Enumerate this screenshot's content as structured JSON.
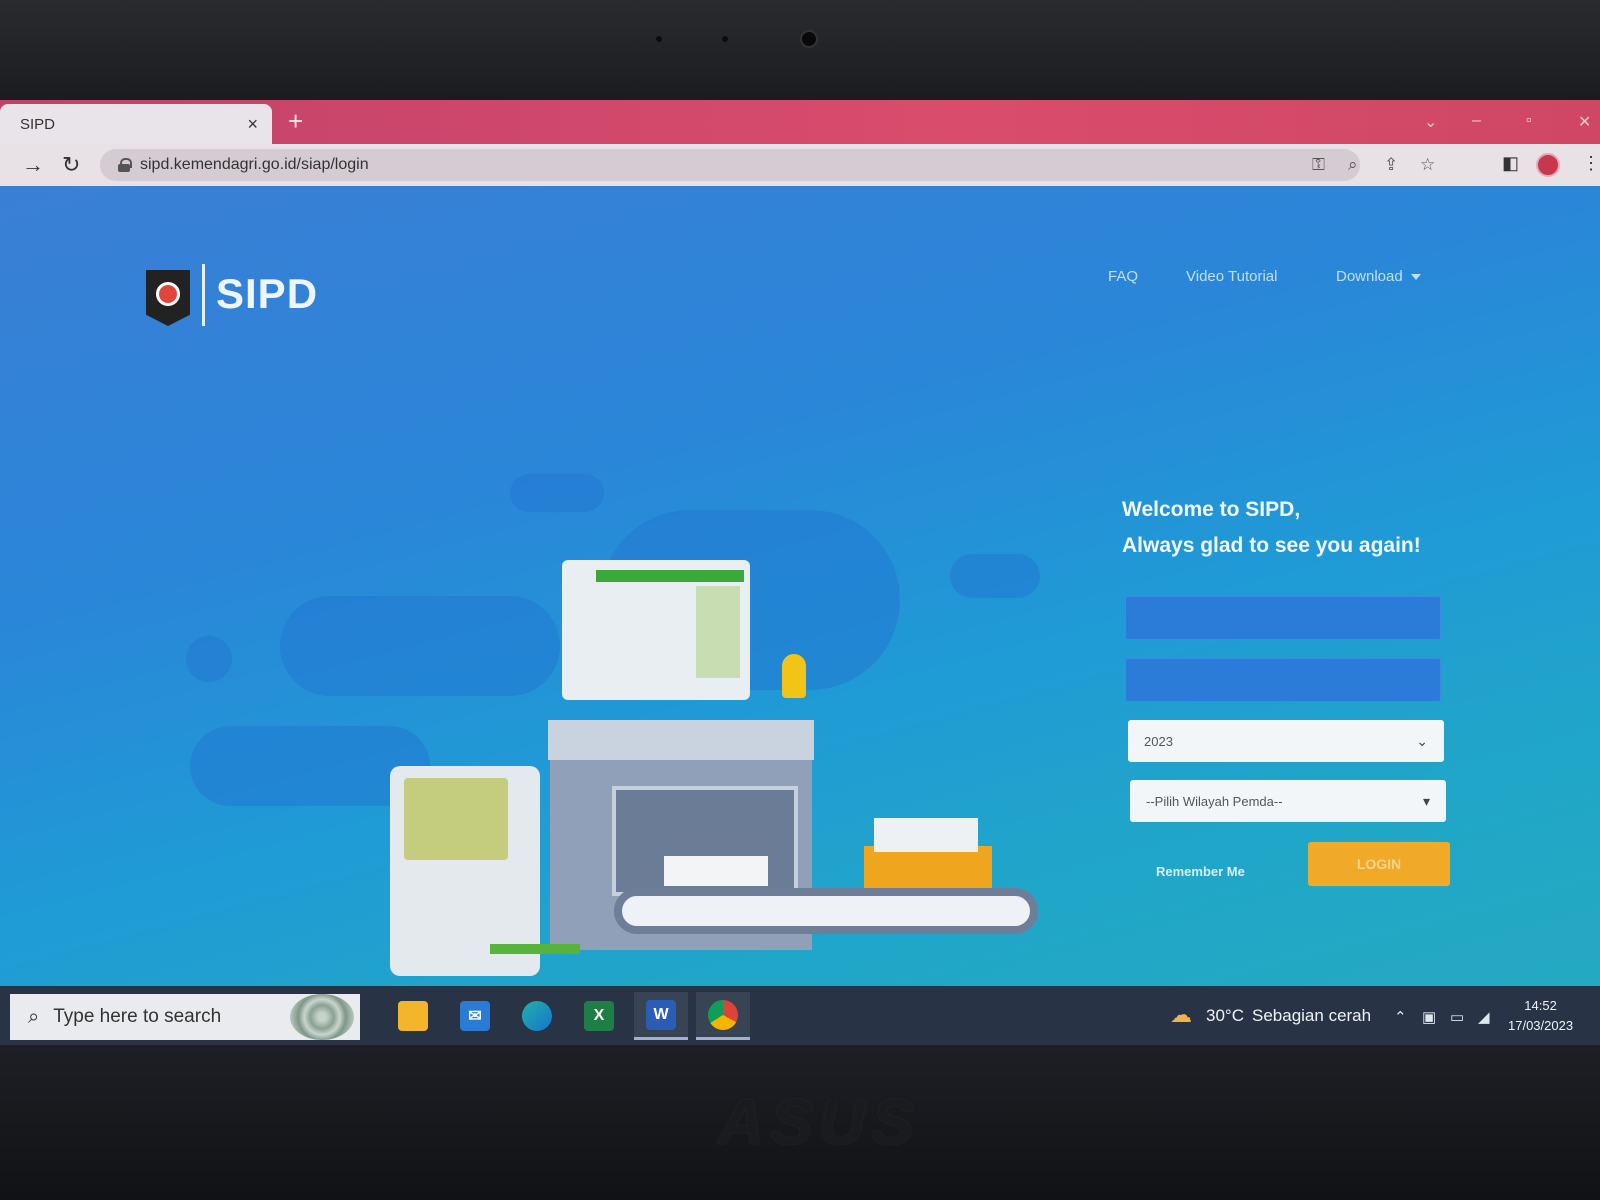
{
  "browser": {
    "tab_title": "SIPD",
    "tab_close": "×",
    "new_tab": "+",
    "url": "sipd.kemendagri.go.id/siap/login"
  },
  "page": {
    "brand": "SIPD",
    "nav": {
      "faq": "FAQ",
      "video_tutorial": "Video Tutorial",
      "download": "Download"
    },
    "welcome_line1": "Welcome to SIPD,",
    "welcome_line2": "Always glad to see you again!",
    "form": {
      "username_value": "",
      "password_value": "",
      "year_selected": "2023",
      "region_selected": "--Pilih Wilayah Pemda--",
      "remember_label": "Remember Me",
      "login_label": "LOGIN"
    },
    "colors": {
      "accent_login": "#f1a928",
      "background": "#2a86d8"
    }
  },
  "taskbar": {
    "search_placeholder": "Type here to search",
    "weather_temp": "30°C",
    "weather_desc": "Sebagian cerah",
    "time": "14:52",
    "date": "17/03/2023",
    "apps": [
      "file-explorer",
      "mail",
      "edge",
      "excel",
      "word",
      "chrome"
    ]
  },
  "device": {
    "brand": "ASUS"
  }
}
